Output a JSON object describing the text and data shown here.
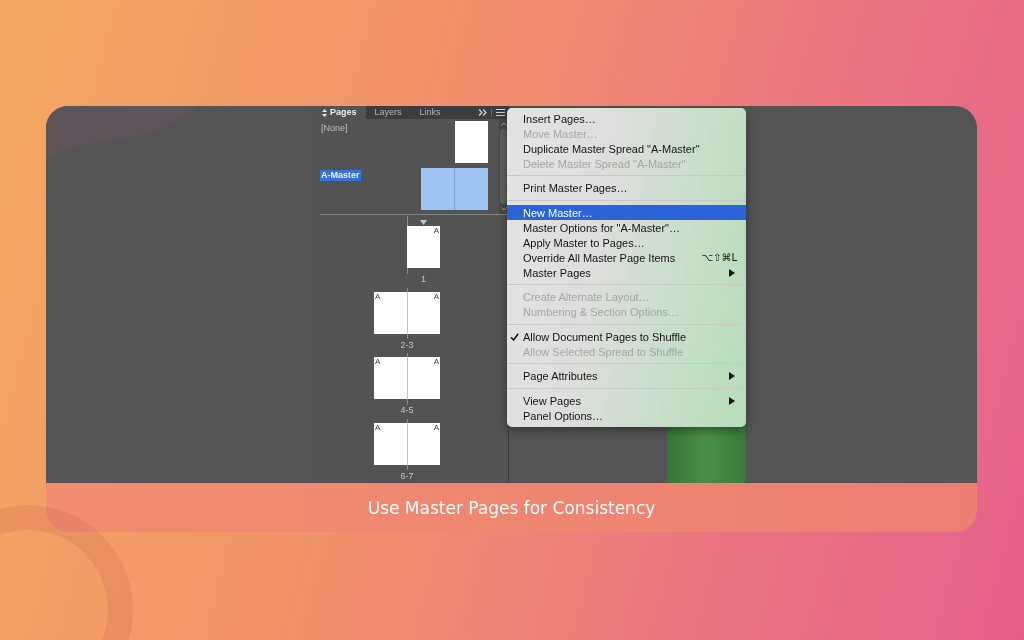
{
  "panel": {
    "tabs": [
      {
        "label": "Pages",
        "selected": true
      },
      {
        "label": "Layers",
        "selected": false
      },
      {
        "label": "Links",
        "selected": false
      }
    ],
    "masters": [
      {
        "label": "[None]",
        "kind": "page",
        "selected": false
      },
      {
        "label": "A-Master",
        "kind": "spread",
        "selected": true
      }
    ],
    "spreads": [
      {
        "label": "1",
        "section_start": true,
        "pages": [
          {
            "master": "A"
          }
        ]
      },
      {
        "label": "2-3",
        "section_start": false,
        "pages": [
          {
            "master": "A"
          },
          {
            "master": "A"
          }
        ]
      },
      {
        "label": "4-5",
        "section_start": false,
        "pages": [
          {
            "master": "A"
          },
          {
            "master": "A"
          }
        ]
      },
      {
        "label": "6-7",
        "section_start": false,
        "pages": [
          {
            "master": "A"
          },
          {
            "master": "A"
          }
        ]
      }
    ]
  },
  "menu": {
    "sections": [
      {
        "items": [
          {
            "label": "Insert Pages…",
            "disabled": false,
            "selected": false,
            "checked": false,
            "submenu": false
          },
          {
            "label": "Move Master…",
            "disabled": true,
            "selected": false,
            "checked": false,
            "submenu": false
          },
          {
            "label": "Duplicate Master Spread \"A-Master\"",
            "disabled": false,
            "selected": false,
            "checked": false,
            "submenu": false
          },
          {
            "label": "Delete Master Spread \"A-Master\"",
            "disabled": true,
            "selected": false,
            "checked": false,
            "submenu": false
          }
        ]
      },
      {
        "items": [
          {
            "label": "Print Master Pages…",
            "disabled": false,
            "selected": false,
            "checked": false,
            "submenu": false
          }
        ]
      },
      {
        "items": [
          {
            "label": "New Master…",
            "disabled": false,
            "selected": true,
            "checked": false,
            "submenu": false
          },
          {
            "label": "Master Options for \"A-Master\"…",
            "disabled": false,
            "selected": false,
            "checked": false,
            "submenu": false
          },
          {
            "label": "Apply Master to Pages…",
            "disabled": false,
            "selected": false,
            "checked": false,
            "submenu": false
          },
          {
            "label": "Override All Master Page Items",
            "shortcut": "⌥⇧⌘L",
            "disabled": false,
            "selected": false,
            "checked": false,
            "submenu": false
          },
          {
            "label": "Master Pages",
            "disabled": false,
            "selected": false,
            "checked": false,
            "submenu": true
          }
        ]
      },
      {
        "items": [
          {
            "label": "Create Alternate Layout…",
            "disabled": true,
            "selected": false,
            "checked": false,
            "submenu": false
          },
          {
            "label": "Numbering & Section Options…",
            "disabled": true,
            "selected": false,
            "checked": false,
            "submenu": false
          }
        ]
      },
      {
        "items": [
          {
            "label": "Allow Document Pages to Shuffle",
            "disabled": false,
            "selected": false,
            "checked": true,
            "submenu": false
          },
          {
            "label": "Allow Selected Spread to Shuffle",
            "disabled": true,
            "selected": false,
            "checked": false,
            "submenu": false
          }
        ]
      },
      {
        "items": [
          {
            "label": "Page Attributes",
            "disabled": false,
            "selected": false,
            "checked": false,
            "submenu": true
          }
        ]
      },
      {
        "items": [
          {
            "label": "View Pages",
            "disabled": false,
            "selected": false,
            "checked": false,
            "submenu": true
          },
          {
            "label": "Panel Options…",
            "disabled": false,
            "selected": false,
            "checked": false,
            "submenu": false
          }
        ]
      }
    ]
  },
  "caption": "Use Master Pages for Consistency"
}
